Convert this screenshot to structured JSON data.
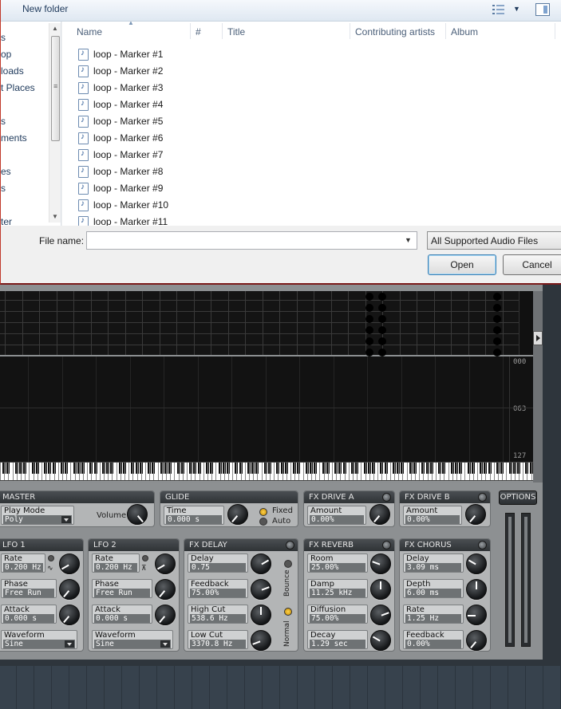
{
  "dialog": {
    "toolbar": {
      "new_folder": "New folder"
    },
    "nav_items": [
      "s",
      "op",
      "loads",
      "t Places",
      "s",
      "ments",
      "es",
      "s",
      "ter"
    ],
    "columns": [
      "Name",
      "#",
      "Title",
      "Contributing artists",
      "Album"
    ],
    "files": [
      "loop - Marker #1",
      "loop - Marker #2",
      "loop - Marker #3",
      "loop - Marker #4",
      "loop - Marker #5",
      "loop - Marker #6",
      "loop - Marker #7",
      "loop - Marker #8",
      "loop - Marker #9",
      "loop - Marker #10",
      "loop - Marker #11"
    ],
    "filename_label": "File name:",
    "filename_value": "",
    "filetype": "All Supported Audio Files",
    "open_label": "Open",
    "cancel_label": "Cancel"
  },
  "synth": {
    "velocity_ticks": [
      "000",
      "063",
      "127"
    ],
    "options_label": "OPTIONS",
    "master": {
      "title": "MASTER",
      "play_mode_label": "Play Mode",
      "play_mode_value": "Poly",
      "volume_label": "Volume"
    },
    "glide": {
      "title": "GLIDE",
      "time_label": "Time",
      "time_value": "0.000 s",
      "fixed_label": "Fixed",
      "auto_label": "Auto"
    },
    "fx_drive_a": {
      "title": "FX DRIVE A",
      "amount_label": "Amount",
      "amount_value": "0.00%"
    },
    "fx_drive_b": {
      "title": "FX DRIVE B",
      "amount_label": "Amount",
      "amount_value": "0.00%"
    },
    "lfo1": {
      "title": "LFO 1",
      "rate_label": "Rate",
      "rate_value": "0.200 Hz",
      "phase_label": "Phase",
      "phase_value": "Free Run",
      "attack_label": "Attack",
      "attack_value": "0.000 s",
      "waveform_label": "Waveform",
      "waveform_value": "Sine"
    },
    "lfo2": {
      "title": "LFO 2",
      "rate_label": "Rate",
      "rate_value": "0.200 Hz",
      "phase_label": "Phase",
      "phase_value": "Free Run",
      "attack_label": "Attack",
      "attack_value": "0.000 s",
      "waveform_label": "Waveform",
      "waveform_value": "Sine"
    },
    "fx_delay": {
      "title": "FX DELAY",
      "delay_label": "Delay",
      "delay_value": "0.75",
      "feedback_label": "Feedback",
      "feedback_value": "75.00%",
      "highcut_label": "High Cut",
      "highcut_value": "538.6 Hz",
      "lowcut_label": "Low Cut",
      "lowcut_value": "3370.8 Hz",
      "bounce_label": "Bounce",
      "normal_label": "Normal"
    },
    "fx_reverb": {
      "title": "FX REVERB",
      "room_label": "Room",
      "room_value": "25.00%",
      "damp_label": "Damp",
      "damp_value": "11.25 kHz",
      "diffusion_label": "Diffusion",
      "diffusion_value": "75.00%",
      "decay_label": "Decay",
      "decay_value": "1.29 sec"
    },
    "fx_chorus": {
      "title": "FX CHORUS",
      "delay_label": "Delay",
      "delay_value": "3.09 ms",
      "depth_label": "Depth",
      "depth_value": "6.00 ms",
      "rate_label": "Rate",
      "rate_value": "1.25 Hz",
      "feedback_label": "Feedback",
      "feedback_value": "0.00%"
    }
  }
}
